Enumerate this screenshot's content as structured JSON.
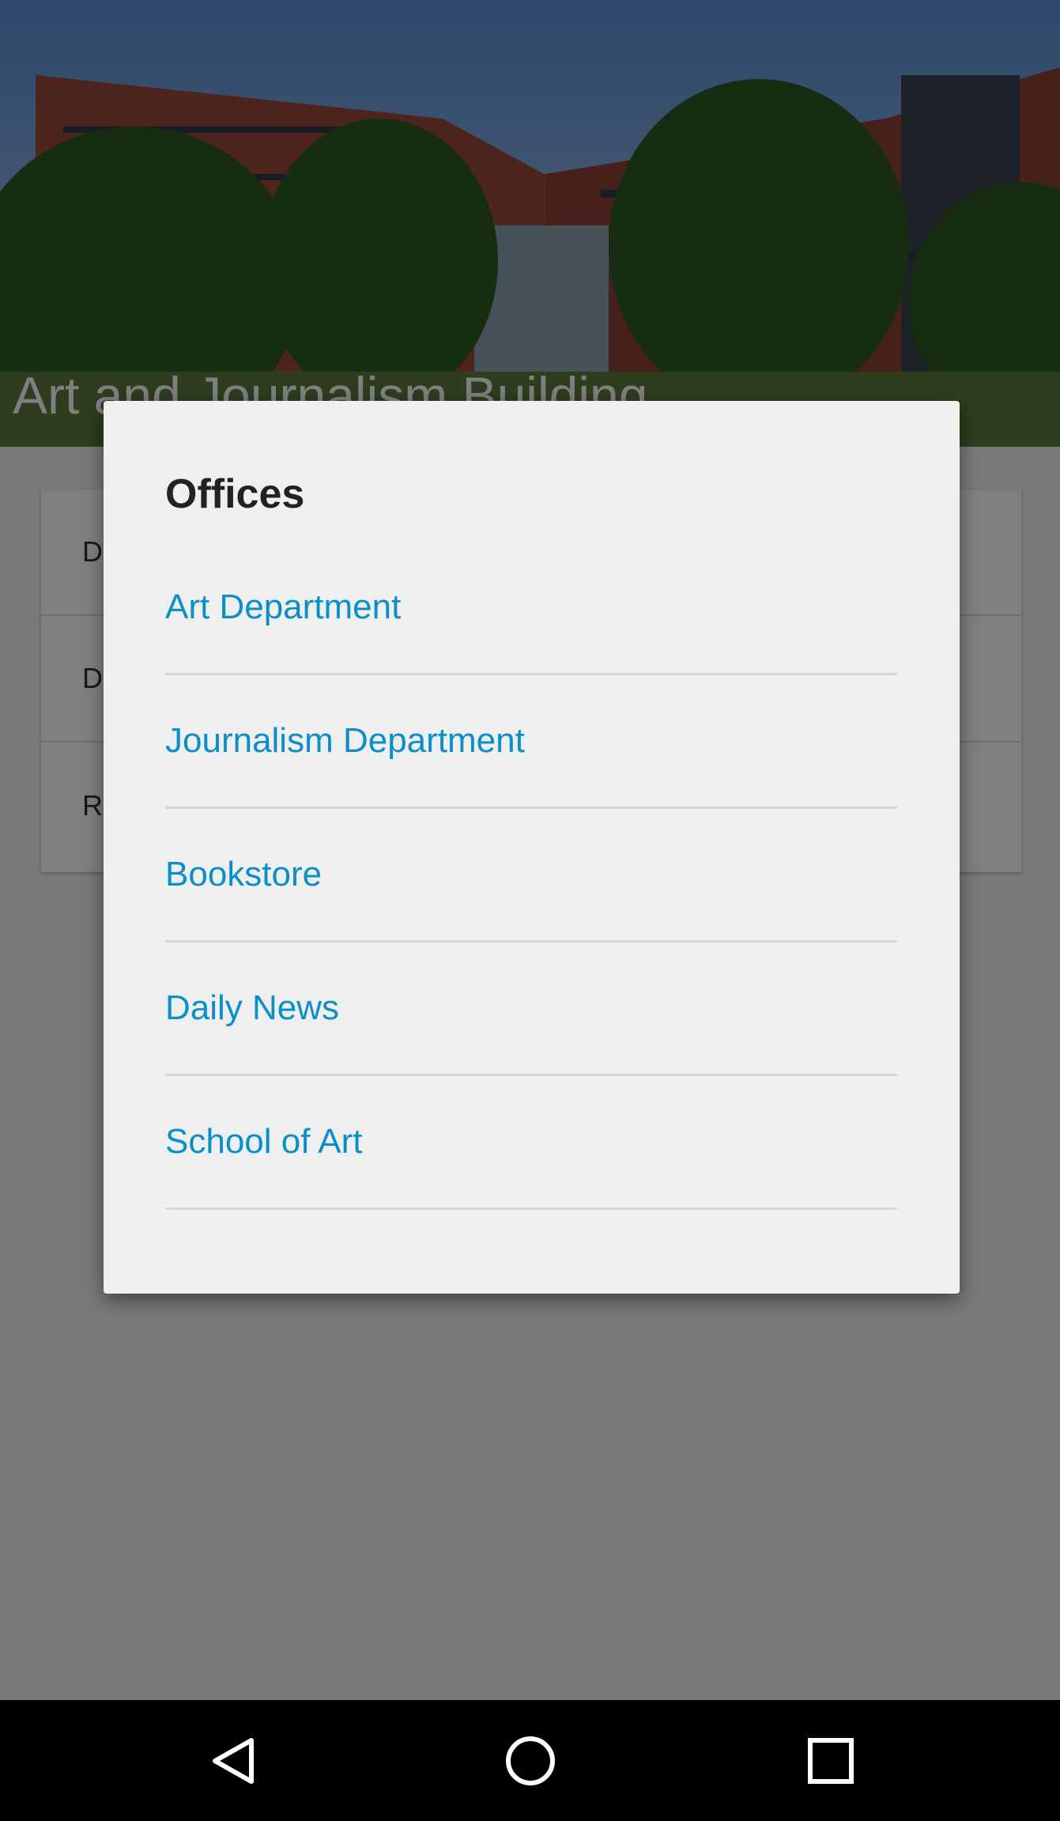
{
  "header": {
    "building_title": "Art and Journalism Building"
  },
  "background_list": {
    "items": [
      "D",
      "D",
      "R"
    ]
  },
  "dialog": {
    "title": "Offices",
    "options": [
      {
        "label": "Art Department"
      },
      {
        "label": "Journalism Department"
      },
      {
        "label": "Bookstore"
      },
      {
        "label": "Daily News"
      },
      {
        "label": "School of Art"
      }
    ]
  },
  "navbar": {
    "icons": [
      "back-icon",
      "home-icon",
      "recents-icon"
    ]
  },
  "colors": {
    "accent": "#0a8fc8",
    "dialog_bg": "#efefef",
    "scrim": "rgba(0,0,0,0.5)"
  }
}
